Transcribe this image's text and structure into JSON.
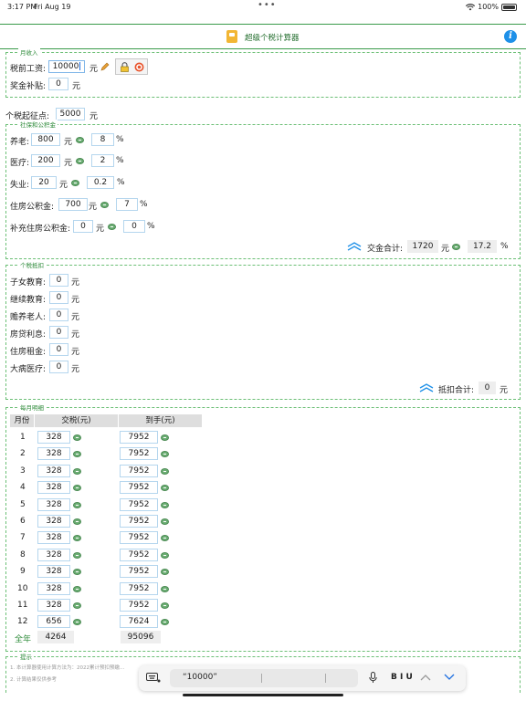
{
  "status": {
    "time": "3:17 PM",
    "date": "Fri Aug 19",
    "battery": "100%"
  },
  "nav": {
    "title": "超级个税计算器"
  },
  "income": {
    "legend": "月收入",
    "salary_label": "税前工资:",
    "salary_value": "10000",
    "salary_unit": "元",
    "bonus_label": "奖金补贴:",
    "bonus_value": "0",
    "bonus_unit": "元"
  },
  "threshold": {
    "label": "个税起征点:",
    "value": "5000",
    "unit": "元"
  },
  "social": {
    "legend": "社保和公积金",
    "rows": [
      {
        "label": "养老:",
        "amount": "800",
        "unit": "元",
        "rate": "8",
        "pct": "%"
      },
      {
        "label": "医疗:",
        "amount": "200",
        "unit": "元",
        "rate": "2",
        "pct": "%"
      },
      {
        "label": "失业:",
        "amount": "20",
        "unit": "元",
        "rate": "0.2",
        "pct": "%"
      },
      {
        "label": "住房公积金:",
        "amount": "700",
        "unit": "元",
        "rate": "7",
        "pct": "%"
      },
      {
        "label": "补充住房公积金:",
        "amount": "0",
        "unit": "元",
        "rate": "0",
        "pct": "%"
      }
    ],
    "total_label": "交金合计:",
    "total_value": "1720",
    "total_unit": "元",
    "total_rate": "17.2",
    "total_pct": "%"
  },
  "deduct": {
    "legend": "个税抵扣",
    "rows": [
      {
        "label": "子女教育:",
        "value": "0",
        "unit": "元"
      },
      {
        "label": "继续教育:",
        "value": "0",
        "unit": "元"
      },
      {
        "label": "赡养老人:",
        "value": "0",
        "unit": "元"
      },
      {
        "label": "房贷利息:",
        "value": "0",
        "unit": "元"
      },
      {
        "label": "住房租金:",
        "value": "0",
        "unit": "元"
      },
      {
        "label": "大病医疗:",
        "value": "0",
        "unit": "元"
      }
    ],
    "total_label": "抵扣合计:",
    "total_value": "0",
    "total_unit": "元"
  },
  "monthly": {
    "legend": "每月明细",
    "headers": [
      "月份",
      "交税(元)",
      "到手(元)"
    ],
    "rows": [
      {
        "m": "1",
        "tax": "328",
        "net": "7952"
      },
      {
        "m": "2",
        "tax": "328",
        "net": "7952"
      },
      {
        "m": "3",
        "tax": "328",
        "net": "7952"
      },
      {
        "m": "4",
        "tax": "328",
        "net": "7952"
      },
      {
        "m": "5",
        "tax": "328",
        "net": "7952"
      },
      {
        "m": "6",
        "tax": "328",
        "net": "7952"
      },
      {
        "m": "7",
        "tax": "328",
        "net": "7952"
      },
      {
        "m": "8",
        "tax": "328",
        "net": "7952"
      },
      {
        "m": "9",
        "tax": "328",
        "net": "7952"
      },
      {
        "m": "10",
        "tax": "328",
        "net": "7952"
      },
      {
        "m": "11",
        "tax": "328",
        "net": "7952"
      },
      {
        "m": "12",
        "tax": "656",
        "net": "7624"
      }
    ],
    "year_label": "全年",
    "year_tax": "4264",
    "year_net": "95096"
  },
  "tips": {
    "legend": "提示",
    "line1": "1. 本计算器使用计算方法为：2022累计预扣预缴…",
    "line2": "2. 计算结果仅供参考"
  },
  "keyboard": {
    "suggestion": "“10000”",
    "format": "B I U"
  },
  "colors": {
    "green": "#2e8b3a",
    "blue": "#1e90e8",
    "box_border": "#b5d6ee"
  }
}
